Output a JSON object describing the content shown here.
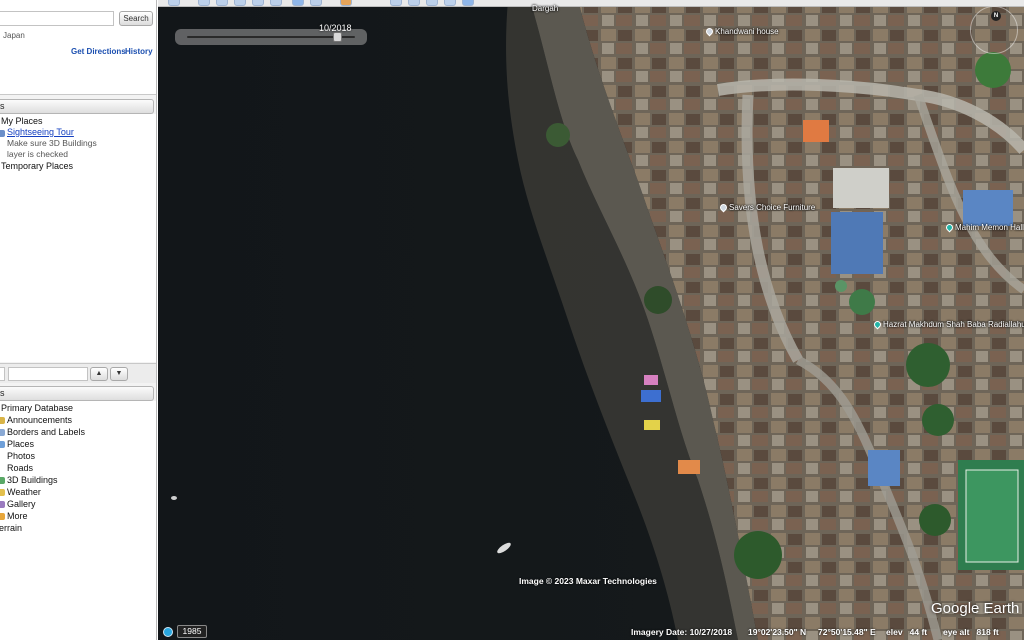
{
  "search": {
    "button_label": "Search",
    "result_text": "Japan",
    "get_directions": "Get Directions",
    "history": "History"
  },
  "places": {
    "header": "s",
    "items": [
      {
        "label": "My Places"
      },
      {
        "label": "Sightseeing Tour"
      },
      {
        "label": "Make sure 3D Buildings"
      },
      {
        "label": "layer is checked"
      },
      {
        "label": "Temporary Places"
      }
    ],
    "up_arrow": "▲",
    "down_arrow": "▼"
  },
  "layers": {
    "header": "s",
    "items": [
      {
        "label": "Primary Database"
      },
      {
        "label": "Announcements"
      },
      {
        "label": "Borders and Labels"
      },
      {
        "label": "Places"
      },
      {
        "label": "Photos"
      },
      {
        "label": "Roads"
      },
      {
        "label": "3D Buildings"
      },
      {
        "label": "Weather"
      },
      {
        "label": "Gallery"
      },
      {
        "label": "More"
      },
      {
        "label": "errain"
      }
    ]
  },
  "map": {
    "time_slider_date": "10/2018",
    "time_slider_level": 0.9,
    "pois": [
      {
        "label": "Dargah"
      },
      {
        "label": "Khandwani house"
      },
      {
        "label": "Savers Choice Furniture"
      },
      {
        "label": "Mahim Memon Hall"
      },
      {
        "label": "Hazrat Makhdum Shah Baba Radiallahuan"
      }
    ],
    "copyright": "Image © 2023 Maxar Technologies",
    "brand": "Google Earth",
    "compass_n": "N"
  },
  "status": {
    "year": "1985",
    "imagery_date": "Imagery Date: 10/27/2018",
    "lat": "19°02'23.50\" N",
    "lon": "72°50'15.48\" E",
    "elev": "elev   44 ft",
    "eye_alt": "eye alt   818 ft"
  },
  "colors": {
    "water": "#13171a",
    "shore": "#4a4842",
    "link": "#1b4fb0"
  }
}
